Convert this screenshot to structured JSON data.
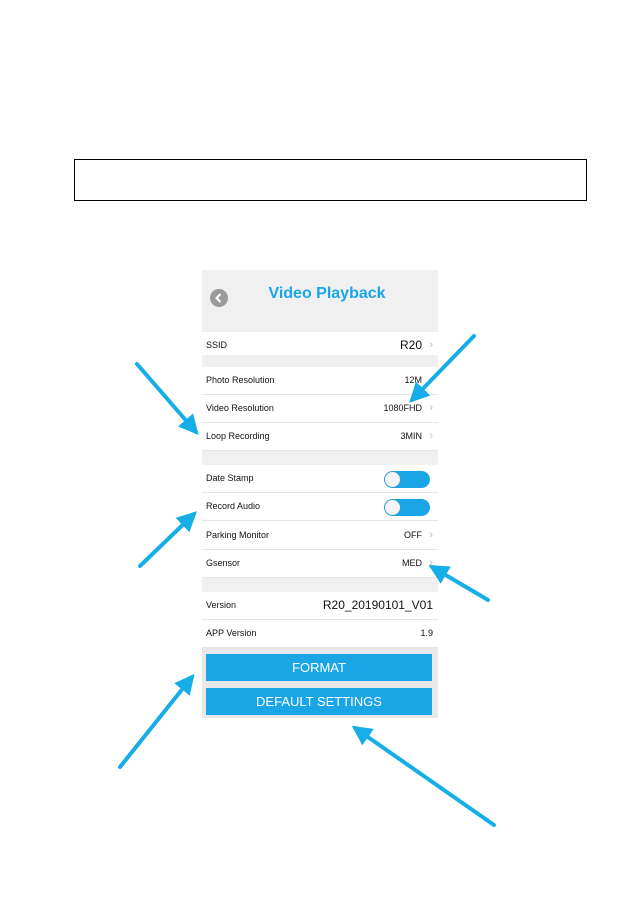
{
  "header": {
    "title": "Video Playback",
    "back_icon": "chevron-left-icon"
  },
  "rows": {
    "ssid": {
      "label": "SSID",
      "value": "R20"
    },
    "photo_resolution": {
      "label": "Photo Resolution",
      "value": "12M"
    },
    "video_resolution": {
      "label": "Video Resolution",
      "value": "1080FHD"
    },
    "loop_recording": {
      "label": "Loop Recording",
      "value": "3MIN"
    },
    "date_stamp": {
      "label": "Date Stamp",
      "enabled": true
    },
    "record_audio": {
      "label": "Record Audio",
      "enabled": true
    },
    "parking_monitor": {
      "label": "Parking Monitor",
      "value": "OFF"
    },
    "gsensor": {
      "label": "Gsensor",
      "value": "MED"
    },
    "version": {
      "label": "Version",
      "value": "R20_20190101_V01"
    },
    "app_version": {
      "label": "APP Version",
      "value": "1.9"
    }
  },
  "buttons": {
    "format": "FORMAT",
    "default_settings": "DEFAULT SETTINGS"
  },
  "colors": {
    "accent": "#1aa6e6",
    "arrow": "#16aee6",
    "section_bg": "#f0f0f0"
  }
}
